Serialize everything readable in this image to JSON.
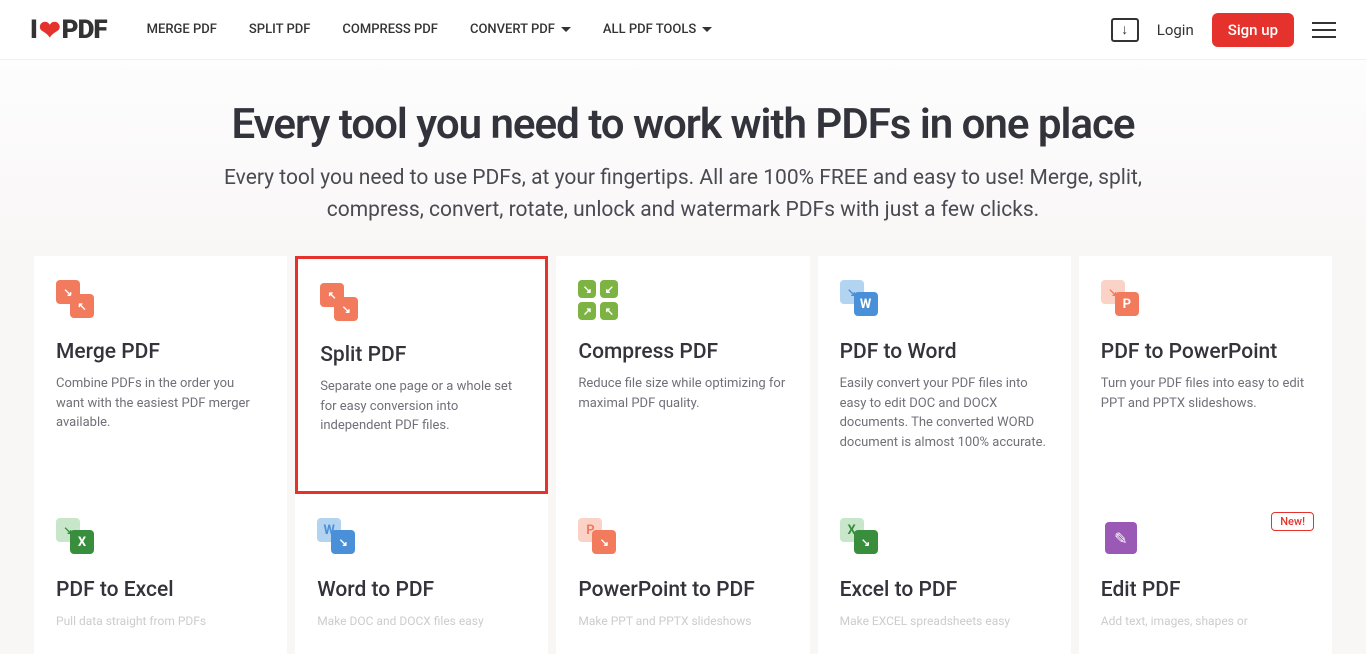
{
  "header": {
    "logo_text_1": "I",
    "logo_text_2": "PDF",
    "nav": [
      "MERGE PDF",
      "SPLIT PDF",
      "COMPRESS PDF",
      "CONVERT PDF",
      "ALL PDF TOOLS"
    ],
    "login": "Login",
    "signup": "Sign up"
  },
  "hero": {
    "title": "Every tool you need to work with PDFs in one place",
    "subtitle": "Every tool you need to use PDFs, at your fingertips. All are 100% FREE and easy to use! Merge, split, compress, convert, rotate, unlock and watermark PDFs with just a few clicks."
  },
  "tools": [
    {
      "title": "Merge PDF",
      "desc": "Combine PDFs in the order you want with the easiest PDF merger available."
    },
    {
      "title": "Split PDF",
      "desc": "Separate one page or a whole set for easy conversion into independent PDF files."
    },
    {
      "title": "Compress PDF",
      "desc": "Reduce file size while optimizing for maximal PDF quality."
    },
    {
      "title": "PDF to Word",
      "desc": "Easily convert your PDF files into easy to edit DOC and DOCX documents. The converted WORD document is almost 100% accurate."
    },
    {
      "title": "PDF to PowerPoint",
      "desc": "Turn your PDF files into easy to edit PPT and PPTX slideshows."
    }
  ],
  "tools2": [
    {
      "title": "PDF to Excel",
      "desc": "Pull data straight from PDFs"
    },
    {
      "title": "Word to PDF",
      "desc": "Make DOC and DOCX files easy"
    },
    {
      "title": "PowerPoint to PDF",
      "desc": "Make PPT and PPTX slideshows"
    },
    {
      "title": "Excel to PDF",
      "desc": "Make EXCEL spreadsheets easy"
    },
    {
      "title": "Edit PDF",
      "desc": "Add text, images, shapes or",
      "badge": "New!"
    }
  ]
}
